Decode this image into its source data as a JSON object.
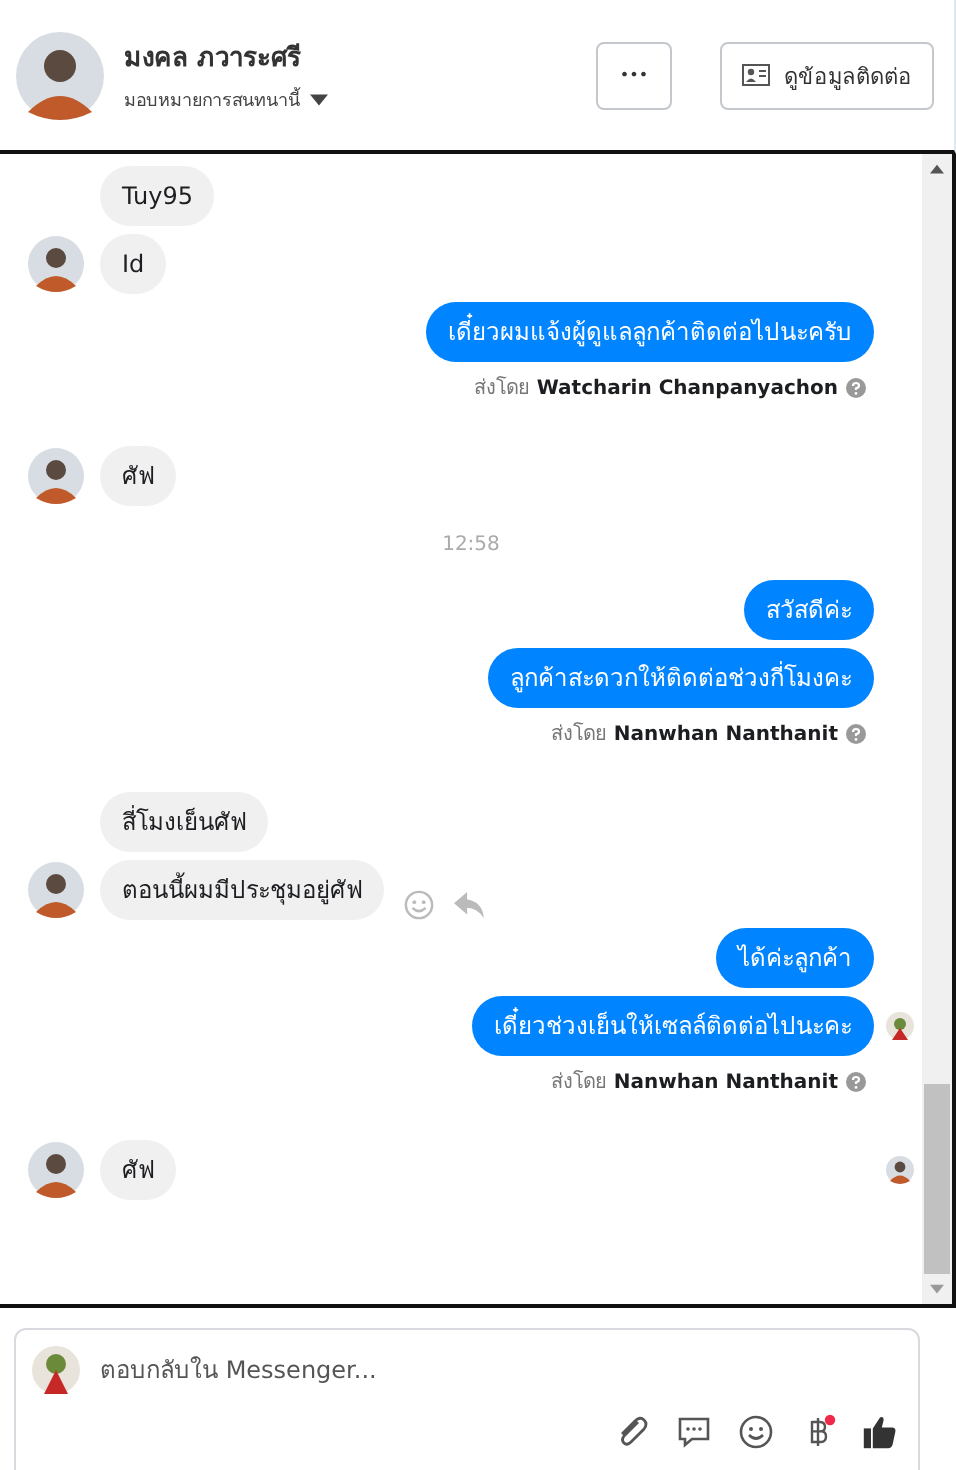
{
  "header": {
    "name": "มงคล ภวาระศรี",
    "assign_label": "มอบหมายการสนทนานี้",
    "more_button": "•••",
    "contact_button": "ดูข้อมูลติดต่อ"
  },
  "messages": [
    {
      "kind": "in",
      "text": "Tuy95",
      "avatar": false
    },
    {
      "kind": "in",
      "text": "Id",
      "avatar": true
    },
    {
      "kind": "out",
      "text": "เดี๋ยวผมแจ้งผู้ดูแลลูกค้าติดต่อไปนะครับ",
      "seen": false
    },
    {
      "kind": "sent_by",
      "prefix": "ส่งโดย",
      "name": "Watcharin Chanpanyachon"
    },
    {
      "kind": "in",
      "text": "ศัฟ",
      "avatar": true
    },
    {
      "kind": "time",
      "text": "12:58"
    },
    {
      "kind": "out",
      "text": "สวัสดีค่ะ",
      "seen": false
    },
    {
      "kind": "out",
      "text": "ลูกค้าสะดวกให้ติดต่อช่วงกี่โมงคะ",
      "seen": false
    },
    {
      "kind": "sent_by",
      "prefix": "ส่งโดย",
      "name": "Nanwhan Nanthanit"
    },
    {
      "kind": "in",
      "text": "สี่โมงเย็นศัฟ",
      "avatar": false
    },
    {
      "kind": "in",
      "text": "ตอนนี้ผมมีประชุมอยู่ศัฟ",
      "avatar": true,
      "actions": true
    },
    {
      "kind": "out",
      "text": "ได้ค่ะลูกค้า",
      "seen": false
    },
    {
      "kind": "out",
      "text": "เดี๋ยวช่วงเย็นให้เซลล์ติดต่อไปนะคะ",
      "seen": true
    },
    {
      "kind": "sent_by",
      "prefix": "ส่งโดย",
      "name": "Nanwhan Nanthanit"
    },
    {
      "kind": "in",
      "text": "ศัฟ",
      "avatar": true,
      "seen": true
    }
  ],
  "composer": {
    "placeholder": "ตอบกลับใน Messenger...",
    "payment_notification": true
  }
}
